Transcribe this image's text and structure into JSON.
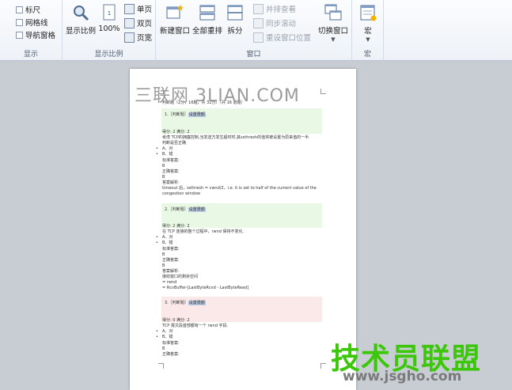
{
  "ribbon": {
    "show_group": {
      "label": "显示",
      "checkboxes": [
        "标尺",
        "网格线",
        "导航窗格"
      ]
    },
    "zoom_group": {
      "label": "显示比例",
      "zoom_label": "显示比例",
      "percent_label": "100%",
      "one_page": "单页",
      "two_pages": "双页",
      "page_width": "页宽"
    },
    "window_group": {
      "label": "窗口",
      "new_window": "新建窗口",
      "arrange_all": "全部重排",
      "split": "拆分",
      "side_by_side": "并排查看",
      "sync_scroll": "同步滚动",
      "reset_position": "重设窗口位置",
      "switch_windows": "切换窗口"
    },
    "macro_group": {
      "label": "宏",
      "macros": "宏"
    }
  },
  "document": {
    "heading": "判断题（2分，16题，共 32分）（共 16 道题）",
    "q1": {
      "label": "1.［判断题］",
      "highlight": "设置限额",
      "score": "得分: 2  满分: 2",
      "lines": [
        "考虑 TCP的拥塞控制,当发送方发生超时时,其ssthresh的值将被设置为原来值的一半.",
        "判断是否正确"
      ],
      "options": [
        "A、对",
        "B、错"
      ],
      "answer_lines": [
        "标准答案:",
        "B",
        "正确答案:",
        "B",
        "答案解析:",
        "timeout 后，ssthresh = cwnd/2，i.e. it is set to half of the current value of the",
        "congestion window"
      ]
    },
    "q2": {
      "label": "2.［判断题］",
      "highlight": "设置限额",
      "score": "得分: 2  满分: 2",
      "lines": [
        "在 TCP 连接的整个过程中，rwnd 保持不变化."
      ],
      "options": [
        "A、对",
        "B、错"
      ],
      "answer_lines": [
        "标准答案:",
        "B",
        "正确答案:",
        "B",
        "答案解析:",
        "接收窗口的剩余空间",
        "= rwnd",
        "= RcvBuffer-[LastByteRcvd - LastByteRead]"
      ]
    },
    "q3": {
      "label": "3.［判断题］",
      "highlight": "设置限额",
      "score": "得分: 0  满分: 2",
      "lines": [
        "TCP 报文段首部都有一个 rwnd 字段."
      ],
      "options": [
        "A、对",
        "B、错"
      ],
      "answer_lines": [
        "标准答案:",
        "B",
        "正确答案:"
      ]
    }
  },
  "watermarks": {
    "top": "三联网 3LIAN.COM",
    "logo": "技术员联盟",
    "url": "www.jsgho.com"
  }
}
